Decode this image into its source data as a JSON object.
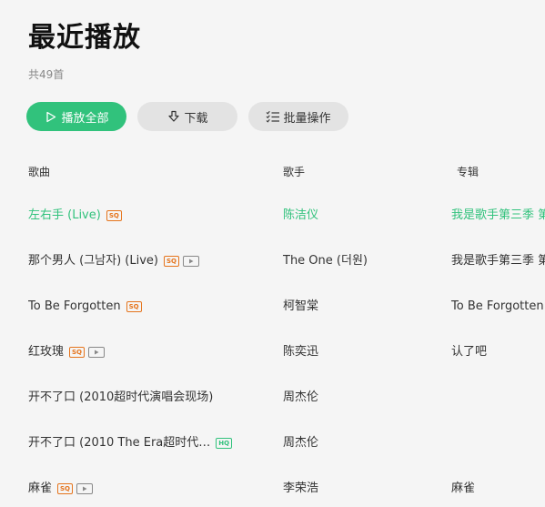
{
  "page": {
    "title": "最近播放",
    "count": "共49首"
  },
  "toolbar": {
    "play_all_label": "播放全部",
    "download_label": "下载",
    "batch_label": "批量操作",
    "accent_color": "#31c27c"
  },
  "columns": {
    "song": "歌曲",
    "artist": "歌手",
    "album": "专辑"
  },
  "songs": [
    {
      "title": "左右手 (Live)",
      "quality": "SQ",
      "mv": false,
      "artist": "陈洁仪",
      "album": "我是歌手第三季 第",
      "playing": true
    },
    {
      "title": "那个男人 (그남자) (Live)",
      "quality": "SQ",
      "mv": true,
      "artist": "The One (더원)",
      "album": "我是歌手第三季 第",
      "playing": false
    },
    {
      "title": "To Be Forgotten",
      "quality": "SQ",
      "mv": false,
      "artist": "柯智棠",
      "album": "To Be Forgotten",
      "playing": false
    },
    {
      "title": "红玫瑰",
      "quality": "SQ",
      "mv": true,
      "artist": "陈奕迅",
      "album": "认了吧",
      "playing": false
    },
    {
      "title": "开不了口 (2010超时代演唱会现场)",
      "quality": "",
      "mv": false,
      "artist": "周杰伦",
      "album": "",
      "playing": false
    },
    {
      "title": "开不了口 (2010 The Era超时代…",
      "quality": "HQ",
      "mv": false,
      "artist": "周杰伦",
      "album": "",
      "playing": false
    },
    {
      "title": "麻雀",
      "quality": "SQ",
      "mv": true,
      "artist": "李荣浩",
      "album": "麻雀",
      "playing": false
    }
  ]
}
